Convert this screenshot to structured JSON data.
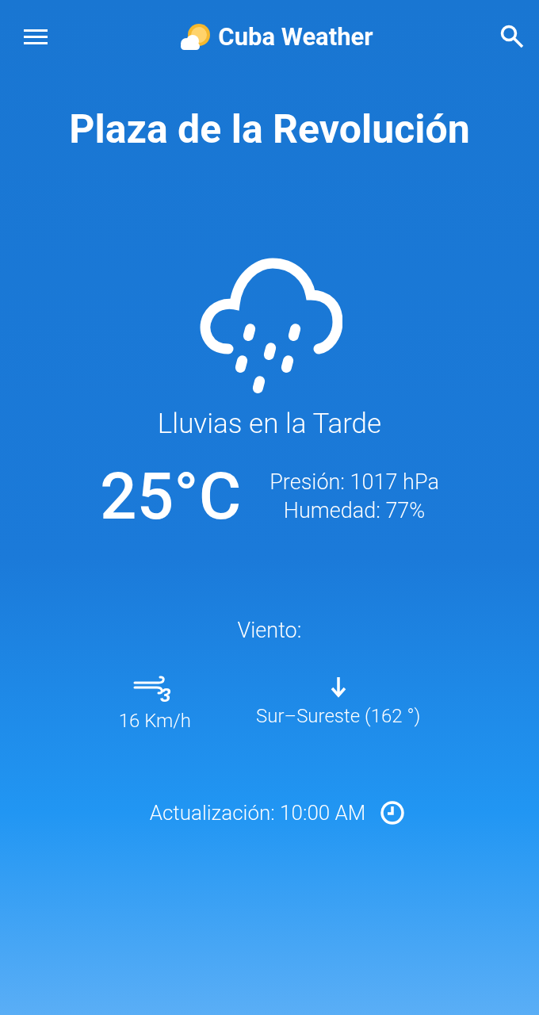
{
  "app_bar": {
    "title": "Cuba Weather"
  },
  "location": "Plaza de la Revolución",
  "condition": "Lluvias en la Tarde",
  "temperature": "25°C",
  "details": [
    "Presión: 1017 hPa",
    "Humedad: 77%"
  ],
  "wind": {
    "label": "Viento:",
    "beaufort": "3",
    "speed": "16 Km/h",
    "direction": "Sur–Sureste (162 °)"
  },
  "updated": "Actualización: 10:00 AM"
}
